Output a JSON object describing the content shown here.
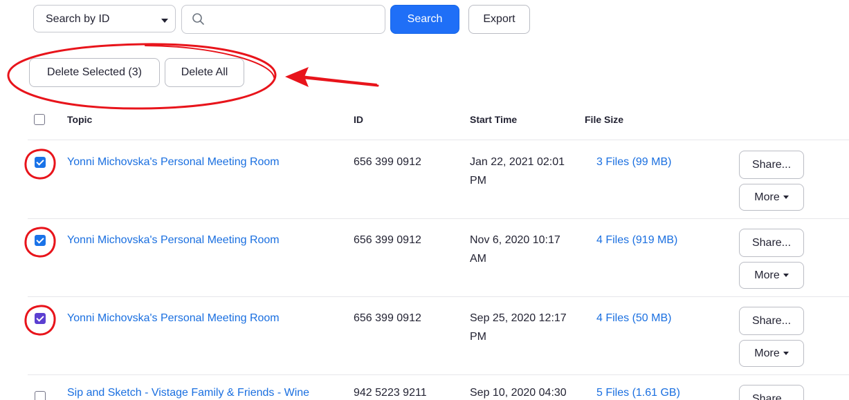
{
  "toolbar": {
    "search_by_label": "Search by ID",
    "search_placeholder": "",
    "search_button": "Search",
    "export_button": "Export",
    "delete_selected_button": "Delete Selected (3)",
    "delete_all_button": "Delete All"
  },
  "table": {
    "headers": {
      "topic": "Topic",
      "id": "ID",
      "start_time": "Start Time",
      "file_size": "File Size"
    },
    "rows": [
      {
        "checked": true,
        "topic": "Yonni Michovska's Personal Meeting Room",
        "id": "656 399 0912",
        "start_line1": "Jan 22, 2021 02:01",
        "start_line2": "PM",
        "files": "3 Files (99 MB)",
        "share": "Share...",
        "more": "More"
      },
      {
        "checked": true,
        "topic": "Yonni Michovska's Personal Meeting Room",
        "id": "656 399 0912",
        "start_line1": "Nov 6, 2020 10:17",
        "start_line2": "AM",
        "files": "4 Files (919 MB)",
        "share": "Share...",
        "more": "More"
      },
      {
        "checked": true,
        "topic": "Yonni Michovska's Personal Meeting Room",
        "id": "656 399 0912",
        "start_line1": "Sep 25, 2020 12:17",
        "start_line2": "PM",
        "files": "4 Files (50 MB)",
        "share": "Share...",
        "more": "More"
      },
      {
        "checked": false,
        "topic": "Sip and Sketch - Vistage Family & Friends - Wine",
        "id": "942 5223 9211",
        "start_line1": "Sep 10, 2020 04:30",
        "start_line2": "",
        "files": "5 Files (1.61 GB)",
        "share": "Share...",
        "more": ""
      }
    ]
  },
  "colors": {
    "accent": "#1f6ff7",
    "link": "#1a6fe0",
    "annotation": "#e8141b"
  }
}
